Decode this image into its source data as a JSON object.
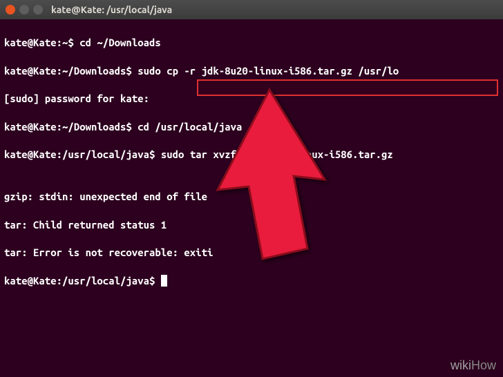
{
  "titlebar": {
    "title": "kate@Kate: /usr/local/java"
  },
  "terminal": {
    "line1_prompt": "kate@Kate:~$ ",
    "line1_cmd": "cd ~/Downloads",
    "line2_prompt": "kate@Kate:~/Downloads$ ",
    "line2_cmd": "sudo cp -r jdk-8u20-linux-i586.tar.gz /usr/lo",
    "line3": "[sudo] password for kate:",
    "line4_prompt": "kate@Kate:~/Downloads$ ",
    "line4_cmd": "cd /usr/local/java",
    "line5_prompt": "kate@Kate:/usr/local/java$ ",
    "line5_cmd": "sudo tar xvzf jdk-8u20-linux-i586.tar.gz",
    "line6": "",
    "line7": "gzip: stdin: unexpected end of file",
    "line8": "tar: Child returned status 1",
    "line9": "tar: Error is not recoverable: exiti",
    "line10_prompt": "kate@Kate:/usr/local/java$ "
  },
  "watermark": {
    "wiki": "wiki",
    "how": "How"
  },
  "colors": {
    "background": "#2c001e",
    "text": "#ffffff",
    "highlight_border": "#e03030",
    "arrow": "#e91e3c"
  }
}
